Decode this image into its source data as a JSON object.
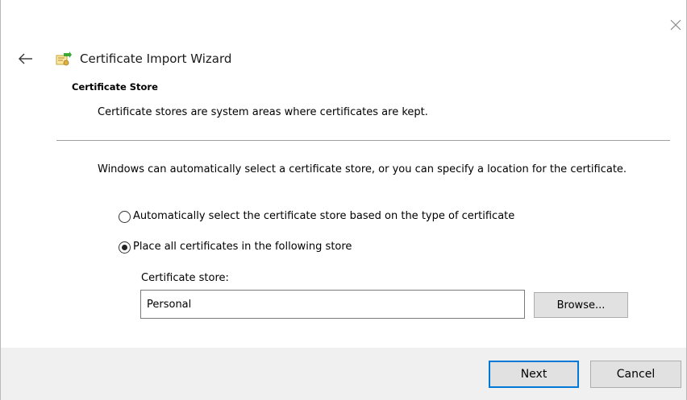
{
  "window": {
    "title": "Certificate Import Wizard",
    "close_icon": "close-icon",
    "back_icon": "back-arrow-icon",
    "app_icon": "certificate-icon"
  },
  "section": {
    "heading": "Certificate Store",
    "description": "Certificate stores are system areas where certificates are kept."
  },
  "body": {
    "intro": "Windows can automatically select a certificate store, or you can specify a location for the certificate.",
    "options": [
      {
        "label": "Automatically select the certificate store based on the type of certificate",
        "selected": false
      },
      {
        "label": "Place all certificates in the following store",
        "selected": true
      }
    ],
    "store_label": "Certificate store:",
    "store_value": "Personal",
    "browse_label": "Browse..."
  },
  "footer": {
    "next_label": "Next",
    "cancel_label": "Cancel"
  },
  "colors": {
    "accent": "#0078d7",
    "footer_bg": "#f0f0f0",
    "button_bg": "#e1e1e1"
  }
}
